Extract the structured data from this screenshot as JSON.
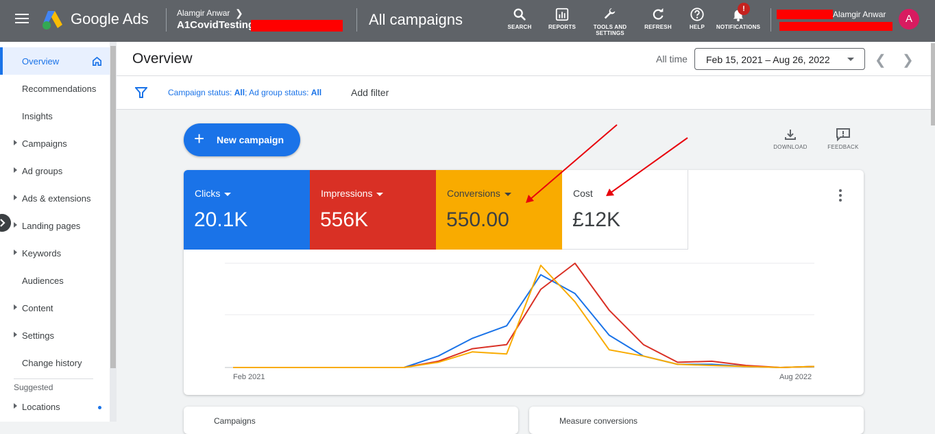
{
  "topbar": {
    "brand": "Google Ads",
    "account_name": "Alamgir Anwar",
    "account_id": "A1CovidTesting",
    "view_title": "All campaigns",
    "tools": [
      {
        "label": "SEARCH",
        "icon": "search-icon"
      },
      {
        "label": "REPORTS",
        "icon": "reports-icon"
      },
      {
        "label": "TOOLS AND SETTINGS",
        "icon": "wrench-icon"
      },
      {
        "label": "REFRESH",
        "icon": "refresh-icon"
      },
      {
        "label": "HELP",
        "icon": "help-icon"
      },
      {
        "label": "NOTIFICATIONS",
        "icon": "bell-icon",
        "badge": "!"
      }
    ],
    "user_name": "Alamgir Anwar",
    "avatar_letter": "A"
  },
  "sidebar": {
    "items": [
      {
        "label": "Overview",
        "active": true
      },
      {
        "label": "Recommendations"
      },
      {
        "label": "Insights"
      },
      {
        "label": "Campaigns",
        "expandable": true
      },
      {
        "label": "Ad groups",
        "expandable": true
      },
      {
        "label": "Ads & extensions",
        "expandable": true
      },
      {
        "label": "Landing pages",
        "expandable": true
      },
      {
        "label": "Keywords",
        "expandable": true
      },
      {
        "label": "Audiences"
      },
      {
        "label": "Content",
        "expandable": true
      },
      {
        "label": "Settings",
        "expandable": true
      },
      {
        "label": "Change history"
      }
    ],
    "suggested_heading": "Suggested",
    "suggested_items": [
      {
        "label": "Locations",
        "expandable": true
      }
    ]
  },
  "header": {
    "title": "Overview",
    "range_label": "All time",
    "date_range": "Feb 15, 2021 – Aug 26, 2022"
  },
  "filters": {
    "campaign_status_label": "Campaign status: ",
    "campaign_status_value": "All",
    "ad_group_status_label": "; Ad group status: ",
    "ad_group_status_value": "All",
    "add_filter": "Add filter"
  },
  "actions": {
    "new_campaign": "New campaign",
    "download": "DOWNLOAD",
    "feedback": "FEEDBACK"
  },
  "metrics": [
    {
      "label": "Clicks",
      "value": "20.1K",
      "color": "#1a73e8"
    },
    {
      "label": "Impressions",
      "value": "556K",
      "color": "#d93025"
    },
    {
      "label": "Conversions",
      "value": "550.00",
      "color": "#f9ab00"
    },
    {
      "label": "Cost",
      "value": "£12K"
    }
  ],
  "chart_data": {
    "type": "line",
    "x_labels": [
      "Feb 2021",
      "Aug 2022"
    ],
    "series": [
      {
        "name": "Clicks",
        "color": "#1a73e8",
        "values": [
          0,
          0,
          0,
          0,
          0,
          0,
          0.11,
          0.28,
          0.4,
          0.89,
          0.71,
          0.31,
          0.11,
          0.03,
          0.03,
          0.01,
          0,
          0.01
        ]
      },
      {
        "name": "Impressions",
        "color": "#d93025",
        "values": [
          0,
          0,
          0,
          0,
          0,
          0,
          0.06,
          0.18,
          0.22,
          0.75,
          1.0,
          0.55,
          0.22,
          0.05,
          0.06,
          0.02,
          0,
          0.01
        ]
      },
      {
        "name": "Conversions",
        "color": "#f9ab00",
        "values": [
          0,
          0,
          0,
          0,
          0,
          0,
          0.05,
          0.15,
          0.13,
          0.98,
          0.63,
          0.17,
          0.11,
          0.03,
          0.02,
          0.01,
          0,
          0.01
        ]
      }
    ],
    "ylim": [
      0,
      1
    ],
    "grid": true,
    "legend": "metric tiles above chart"
  },
  "bottom_cards": [
    "Campaigns",
    "Measure conversions"
  ]
}
